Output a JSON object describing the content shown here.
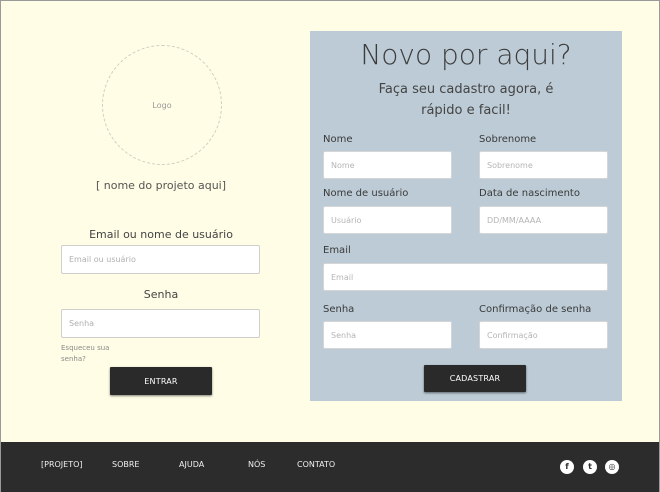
{
  "login": {
    "logo_text": "Logo",
    "project_name": "[ nome do projeto aqui]",
    "email_label": "Email ou nome de usuário",
    "email_placeholder": "Email ou usuário",
    "password_label": "Senha",
    "password_placeholder": "Senha",
    "forgot_text": "Esqueceu sua senha?",
    "submit_label": "ENTRAR"
  },
  "register": {
    "title": "Novo por aqui?",
    "subtitle": "Faça seu cadastro agora, é rápido e facil!",
    "first_name_label": "Nome",
    "first_name_placeholder": "Nome",
    "last_name_label": "Sobrenome",
    "last_name_placeholder": "Sobrenome",
    "username_label": "Nome de usuário",
    "username_placeholder": "Usuário",
    "birth_label": "Data de nascimento",
    "birth_placeholder": "DD/MM/AAAA",
    "email_label": "Email",
    "email_placeholder": "Email",
    "password_label": "Senha",
    "password_placeholder": "Senha",
    "confirm_label": "Confirmação de senha",
    "confirm_placeholder": "Confirmação",
    "submit_label": "CADASTRAR"
  },
  "footer": {
    "links": [
      "[PROJETO]",
      "SOBRE",
      "AJUDA",
      "NÓS",
      "CONTATO"
    ],
    "social_icons": [
      "facebook-icon",
      "twitter-icon",
      "dribbble-icon"
    ],
    "social_glyphs": [
      "f",
      "t",
      "◎"
    ]
  },
  "colors": {
    "page_bg": "#fffde6",
    "register_panel": "#bccbd5",
    "footer_bg": "#2c2c2c",
    "button_bg": "#2a2a2a"
  }
}
